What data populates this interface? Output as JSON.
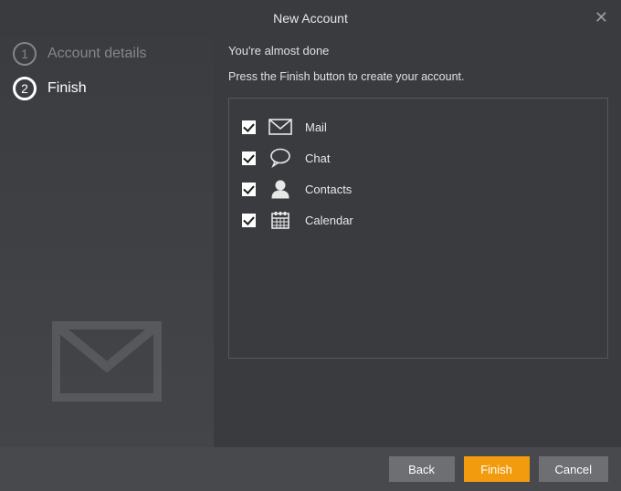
{
  "header": {
    "title": "New Account"
  },
  "sidebar": {
    "steps": [
      {
        "num": "1",
        "label": "Account details",
        "active": false
      },
      {
        "num": "2",
        "label": "Finish",
        "active": true
      }
    ]
  },
  "main": {
    "subtitle": "You're almost done",
    "instruction": "Press the Finish button to create your account.",
    "options": [
      {
        "label": "Mail",
        "checked": true,
        "icon": "mail-icon"
      },
      {
        "label": "Chat",
        "checked": true,
        "icon": "chat-icon"
      },
      {
        "label": "Contacts",
        "checked": true,
        "icon": "contacts-icon"
      },
      {
        "label": "Calendar",
        "checked": true,
        "icon": "calendar-icon"
      }
    ]
  },
  "footer": {
    "back": "Back",
    "finish": "Finish",
    "cancel": "Cancel"
  }
}
